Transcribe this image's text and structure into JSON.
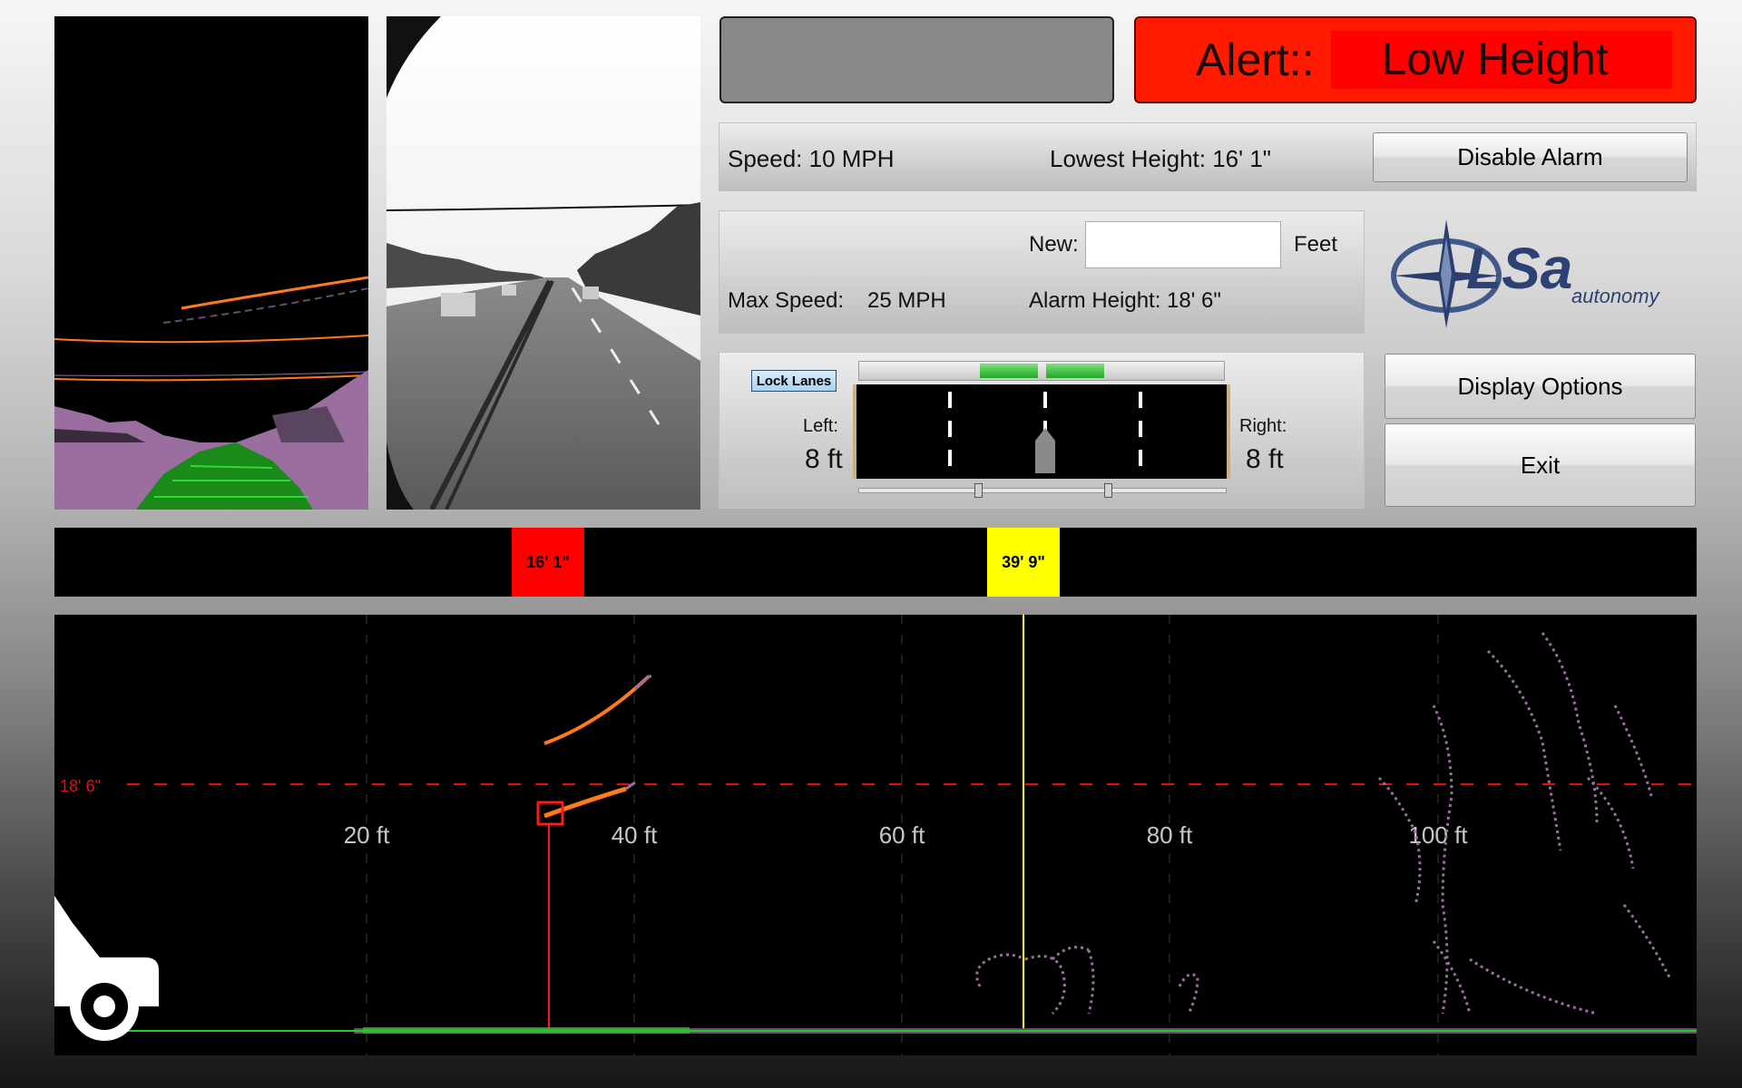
{
  "alert": {
    "prefix": "Alert::",
    "message": "Low Height"
  },
  "info": {
    "speed": "Speed: 10 MPH",
    "lowest_height": "Lowest Height: 16' 1\"",
    "disable_alarm_label": "Disable Alarm"
  },
  "settings": {
    "new_label": "New:",
    "new_value": "",
    "feet_label": "Feet",
    "max_speed_label": "Max Speed:",
    "max_speed_value": "25 MPH",
    "alarm_height": "Alarm Height: 18' 6\""
  },
  "logo": {
    "main": "LSa",
    "sub": "autonomy"
  },
  "lanes": {
    "lock_label": "Lock Lanes",
    "left_label": "Left:",
    "left_value": "8 ft",
    "right_label": "Right:",
    "right_value": "8 ft"
  },
  "buttons": {
    "display_options": "Display Options",
    "exit": "Exit"
  },
  "marker_bar": {
    "markers": [
      {
        "label": "16' 1\"",
        "color": "#ff0000"
      },
      {
        "label": "39' 9\"",
        "color": "#ffff00"
      }
    ]
  },
  "profile": {
    "threshold_label": "18' 6\"",
    "distance_labels": [
      "20 ft",
      "40 ft",
      "60 ft",
      "80 ft",
      "100 ft"
    ]
  },
  "colors": {
    "alert_bg": "#ff1a00",
    "threshold_line": "#e01010",
    "ground_points": "#22cc22",
    "overhead_points": "#ff7a1a",
    "object_points": "#9a6fa0"
  }
}
